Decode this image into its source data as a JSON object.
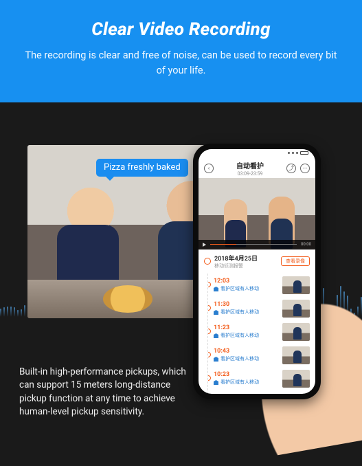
{
  "hero": {
    "title": "Clear Video Recording",
    "subtitle": "The recording is clear and free of noise,\ncan be used to record every bit of your life."
  },
  "bubble_text": "Pizza freshly baked",
  "caption": "Built-in high-performance pickups, which can support 15 meters long-distance pickup function at any time to achieve human-level pickup sensitivity.",
  "phone": {
    "nav_title": "自动看护",
    "nav_sub": "03:09-23:59",
    "video_time": "00:00",
    "date": "2018年4月25日",
    "date_sub": "移动侦测报警",
    "pill": "查看录像",
    "events": [
      {
        "time": "12:03",
        "label": "看护区域有人移动"
      },
      {
        "time": "11:30",
        "label": "看护区域有人移动"
      },
      {
        "time": "11:23",
        "label": "看护区域有人移动"
      },
      {
        "time": "10:43",
        "label": "看护区域有人移动"
      },
      {
        "time": "10:23",
        "label": "看护区域有人移动"
      }
    ]
  }
}
